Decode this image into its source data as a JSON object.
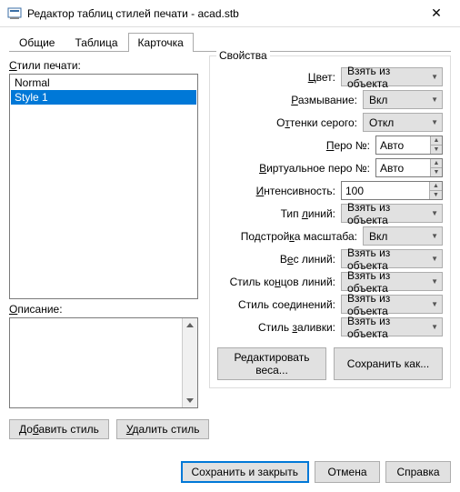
{
  "window": {
    "title": "Редактор таблиц стилей печати - acad.stb",
    "close": "✕"
  },
  "tabs": {
    "general": "Общие",
    "table": "Таблица",
    "card": "Карточка"
  },
  "left": {
    "styles_label": "Стили печати:",
    "styles": [
      "Normal",
      "Style 1"
    ],
    "desc_label": "Описание:",
    "add_btn": "Добавить стиль",
    "del_btn": "Удалить стиль"
  },
  "props": {
    "legend": "Свойства",
    "color_lbl": "Цвет:",
    "color_val": "Взять из объекта",
    "dither_lbl": "Размывание:",
    "dither_val": "Вкл",
    "gray_lbl": "Оттенки серого:",
    "gray_val": "Откл",
    "pen_lbl": "Перо №:",
    "pen_val": "Авто",
    "vpen_lbl": "Виртуальное перо №:",
    "vpen_val": "Авто",
    "intensity_lbl": "Интенсивность:",
    "intensity_val": "100",
    "linetype_lbl": "Тип линий:",
    "linetype_val": "Взять из объекта",
    "adaptive_lbl": "Подстройка масштаба:",
    "adaptive_val": "Вкл",
    "weight_lbl": "Вес линий:",
    "weight_val": "Взять из объекта",
    "endstyle_lbl": "Стиль концов линий:",
    "endstyle_val": "Взять из объекта",
    "joinstyle_lbl": "Стиль соединений:",
    "joinstyle_val": "Взять из объекта",
    "fillstyle_lbl": "Стиль заливки:",
    "fillstyle_val": "Взять из объекта",
    "edit_weights_btn": "Редактировать веса...",
    "save_as_btn": "Сохранить как..."
  },
  "footer": {
    "save_close": "Сохранить и закрыть",
    "cancel": "Отмена",
    "help": "Справка"
  }
}
